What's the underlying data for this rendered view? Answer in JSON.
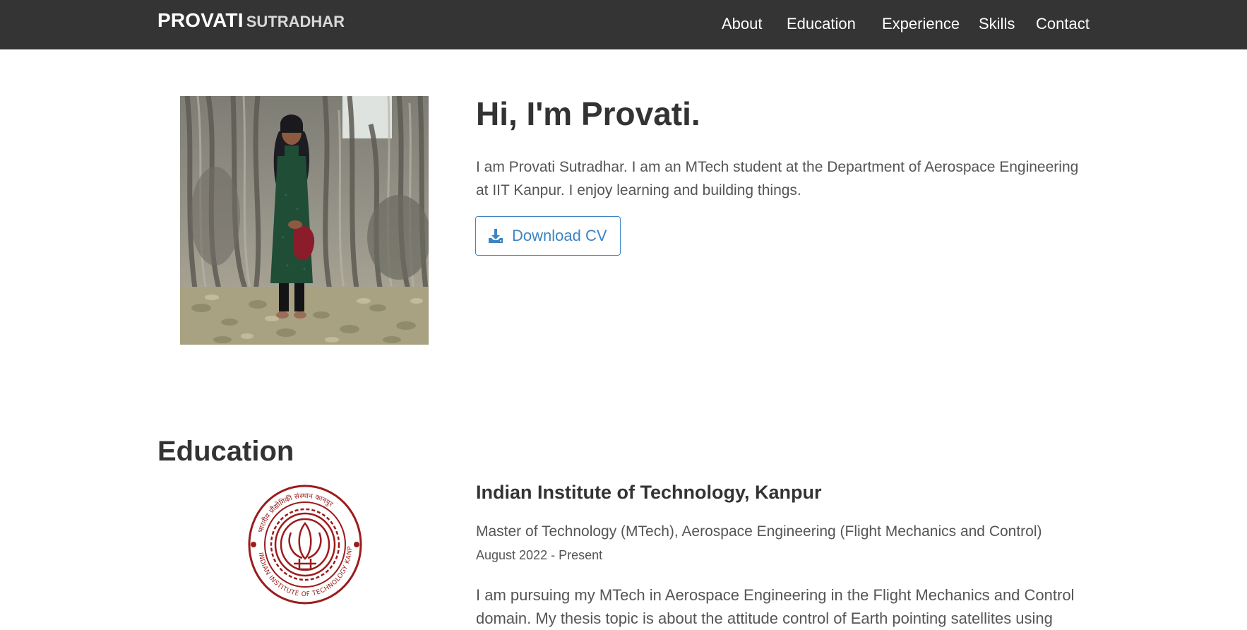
{
  "navbar": {
    "brand_first": "PROVATI",
    "brand_last": "SUTRADHAR",
    "links": [
      "About",
      "Education",
      "Experience",
      "Skills",
      "Contact"
    ]
  },
  "hero": {
    "title": "Hi, I'm Provati.",
    "text": "I am Provati Sutradhar. I am an MTech student at the Department of Aerospace Engineering at IIT Kanpur. I enjoy learning and building things.",
    "cv_button": "Download CV",
    "cv_icon": "download-icon"
  },
  "education": {
    "section_title": "Education",
    "school": "Indian Institute of Technology, Kanpur",
    "degree": "Master of Technology (MTech), Aerospace Engineering (Flight Mechanics and Control)",
    "dates": "August 2022 - Present",
    "description": "I am pursuing my MTech in Aerospace Engineering in the Flight Mechanics and Control domain. My thesis topic is about the attitude control of Earth pointing satellites using",
    "logo_text": "INDIAN INSTITUTE OF TECHNOLOGY KANPUR"
  },
  "colors": {
    "navbar_bg": "#343434",
    "accent": "#3c84c5",
    "logo": "#9b1c1c"
  }
}
